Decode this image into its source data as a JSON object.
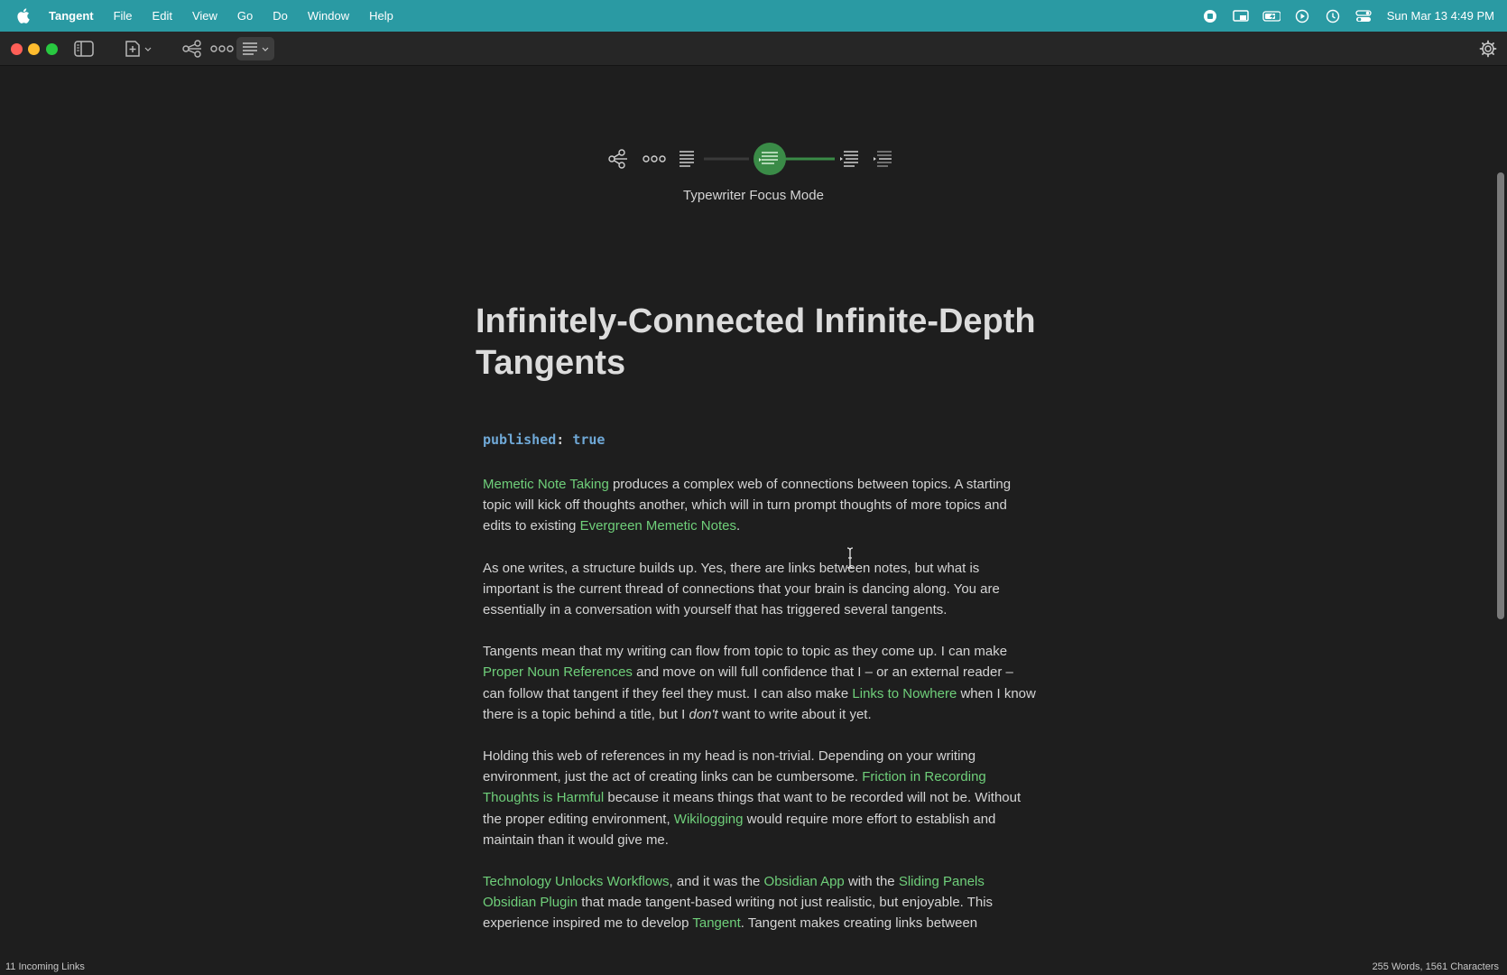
{
  "menubar": {
    "app_name": "Tangent",
    "menus": [
      "File",
      "Edit",
      "View",
      "Go",
      "Do",
      "Window",
      "Help"
    ],
    "datetime": "Sun Mar 13  4:49 PM",
    "status_icons": [
      "screen-record-icon",
      "screen-mirror-icon",
      "battery-charging-icon",
      "play-icon",
      "time-machine-icon",
      "control-center-icon"
    ]
  },
  "focus_modes": {
    "current_label": "Typewriter Focus Mode",
    "accent_color": "#3a8b47"
  },
  "document": {
    "title": "Infinitely-Connected Infinite-Depth Tangents",
    "frontmatter": {
      "key": "published",
      "colon": ":",
      "value": "true"
    },
    "p1": {
      "link1": "Memetic Note Taking",
      "t1": " produces a complex web of connections between topics. A starting topic will kick off thoughts another, which will in turn prompt thoughts of more topics and edits to existing ",
      "link2": "Evergreen Memetic Notes",
      "t2": "."
    },
    "p2": "As one writes, a structure builds up. Yes, there are links between notes, but what is important is the current thread of connections that your brain is dancing along. You are essentially in a conversation with yourself that has triggered several tangents.",
    "p3": {
      "t1": "Tangents mean that my writing can flow from topic to topic as they come up. I can make ",
      "link1": "Proper Noun References",
      "t2": " and move on will full confidence that I – or an external reader – can follow that tangent if they feel they must. I can also make ",
      "link2": "Links to Nowhere",
      "t3": " when I know there is a topic behind a title, but I ",
      "em": "don't",
      "t4": " want to write about it yet."
    },
    "p4": {
      "t1": "Holding this web of references in my head is non-trivial. Depending on your writing environment, just the act of creating links can be cumbersome. ",
      "link1": "Friction in Recording Thoughts is Harmful",
      "t2": " because it means things that want to be recorded will not be. Without the proper editing environment, ",
      "link2": "Wikilogging",
      "t3": " would require more effort to establish and maintain than it would give me."
    },
    "p5": {
      "link1": "Technology Unlocks Workflows",
      "t1": ", and it was the ",
      "link2": "Obsidian App",
      "t2": " with the ",
      "link3": "Sliding Panels Obsidian Plugin",
      "t3": " that made tangent-based writing not just realistic, but enjoyable. This experience inspired me to develop ",
      "link4": "Tangent",
      "t4": ". Tangent makes creating links between"
    }
  },
  "statusbar": {
    "incoming_links": "11 Incoming Links",
    "counts": "255 Words, 1561 Characters"
  },
  "colors": {
    "menubar_bg": "#2a9aa3",
    "editor_bg": "#1e1e1e",
    "link": "#6fcf7a",
    "frontmatter": "#6fa8d6"
  }
}
